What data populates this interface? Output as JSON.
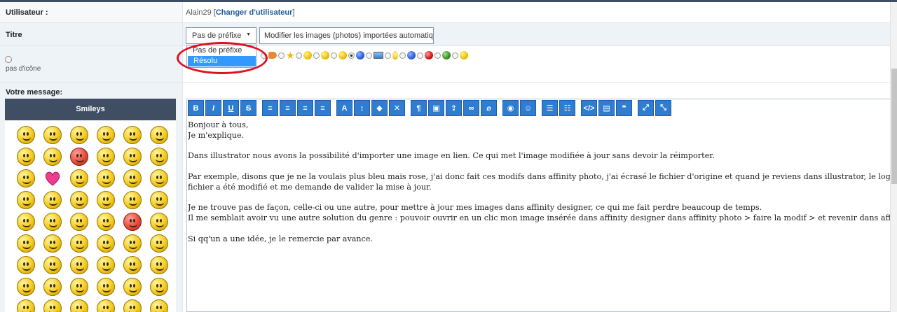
{
  "form": {
    "user_label": "Utilisateur :",
    "user_name": "Alain29",
    "change_user_link": "Changer d'utilisateur",
    "title_label": "Titre",
    "prefix_selected": "Pas de préfixe",
    "title_value": "Modifier les images (photos) importées automatiq",
    "no_icon_label": "pas d'icône",
    "message_label": "Votre message:"
  },
  "prefix_dropdown": {
    "options": [
      "Pas de préfixe",
      "Résolu"
    ],
    "highlighted": "Résolu"
  },
  "smileys": {
    "header": "Smileys"
  },
  "toolbar": {
    "buttons": [
      {
        "name": "bold",
        "label": "B"
      },
      {
        "name": "italic",
        "label": "I"
      },
      {
        "name": "underline",
        "label": "U"
      },
      {
        "name": "strikethrough",
        "label": "S"
      },
      {
        "name": "align-left",
        "label": "≡"
      },
      {
        "name": "align-center",
        "label": "≡"
      },
      {
        "name": "align-right",
        "label": "≡"
      },
      {
        "name": "justify",
        "label": "≡"
      },
      {
        "name": "font-size",
        "label": "A"
      },
      {
        "name": "line-height",
        "label": "↕"
      },
      {
        "name": "color",
        "label": "◆"
      },
      {
        "name": "remove-format",
        "label": "✕"
      },
      {
        "name": "paragraph",
        "label": "¶"
      },
      {
        "name": "image",
        "label": "▣"
      },
      {
        "name": "upload",
        "label": "⇪"
      },
      {
        "name": "link",
        "label": "∞"
      },
      {
        "name": "unlink",
        "label": "⌀"
      },
      {
        "name": "camera",
        "label": "◉"
      },
      {
        "name": "emoji",
        "label": "☺"
      },
      {
        "name": "bulleted-list",
        "label": "☰"
      },
      {
        "name": "numbered-list",
        "label": "☷"
      },
      {
        "name": "code",
        "label": "</>"
      },
      {
        "name": "document",
        "label": "▤"
      },
      {
        "name": "quote",
        "label": "❝"
      },
      {
        "name": "expand",
        "label": "⤢"
      },
      {
        "name": "collapse",
        "label": "⤡"
      }
    ]
  },
  "editor": {
    "lines": [
      "Bonjour à tous,",
      "Je m'explique.",
      "",
      "Dans illustrator nous avons la possibilité d'importer une image en lien. Ce qui met l'image modifiée à jour sans devoir la réimporter.",
      "",
      "Par exemple, disons que je ne la voulais plus bleu mais rose, j'ai donc fait ces modifs dans affinity photo, j'ai écrasé le fichier d'origine et quand je reviens dans illustrator, le logiciel me dit que le",
      "fichier a été modifié et me demande de valider la mise à jour.",
      "",
      "Je ne trouve pas de façon, celle-ci ou une autre, pour mettre à jour mes images dans affinity designer, ce qui me fait perdre beaucoup de temps.",
      "Il me semblait avoir vu une autre solution du genre : pouvoir ouvrir en un clic mon image insérée dans affinity designer dans affinity photo > faire la modif > et revenir dans affinity designer",
      "",
      "Si qq'un a une idée, je le remercie par avance."
    ]
  },
  "colors": {
    "header_bg": "#3f4e63",
    "toolbar_button": "#2e7dd1",
    "selection": "#3399ff",
    "annotation_oval": "#e0101e"
  }
}
